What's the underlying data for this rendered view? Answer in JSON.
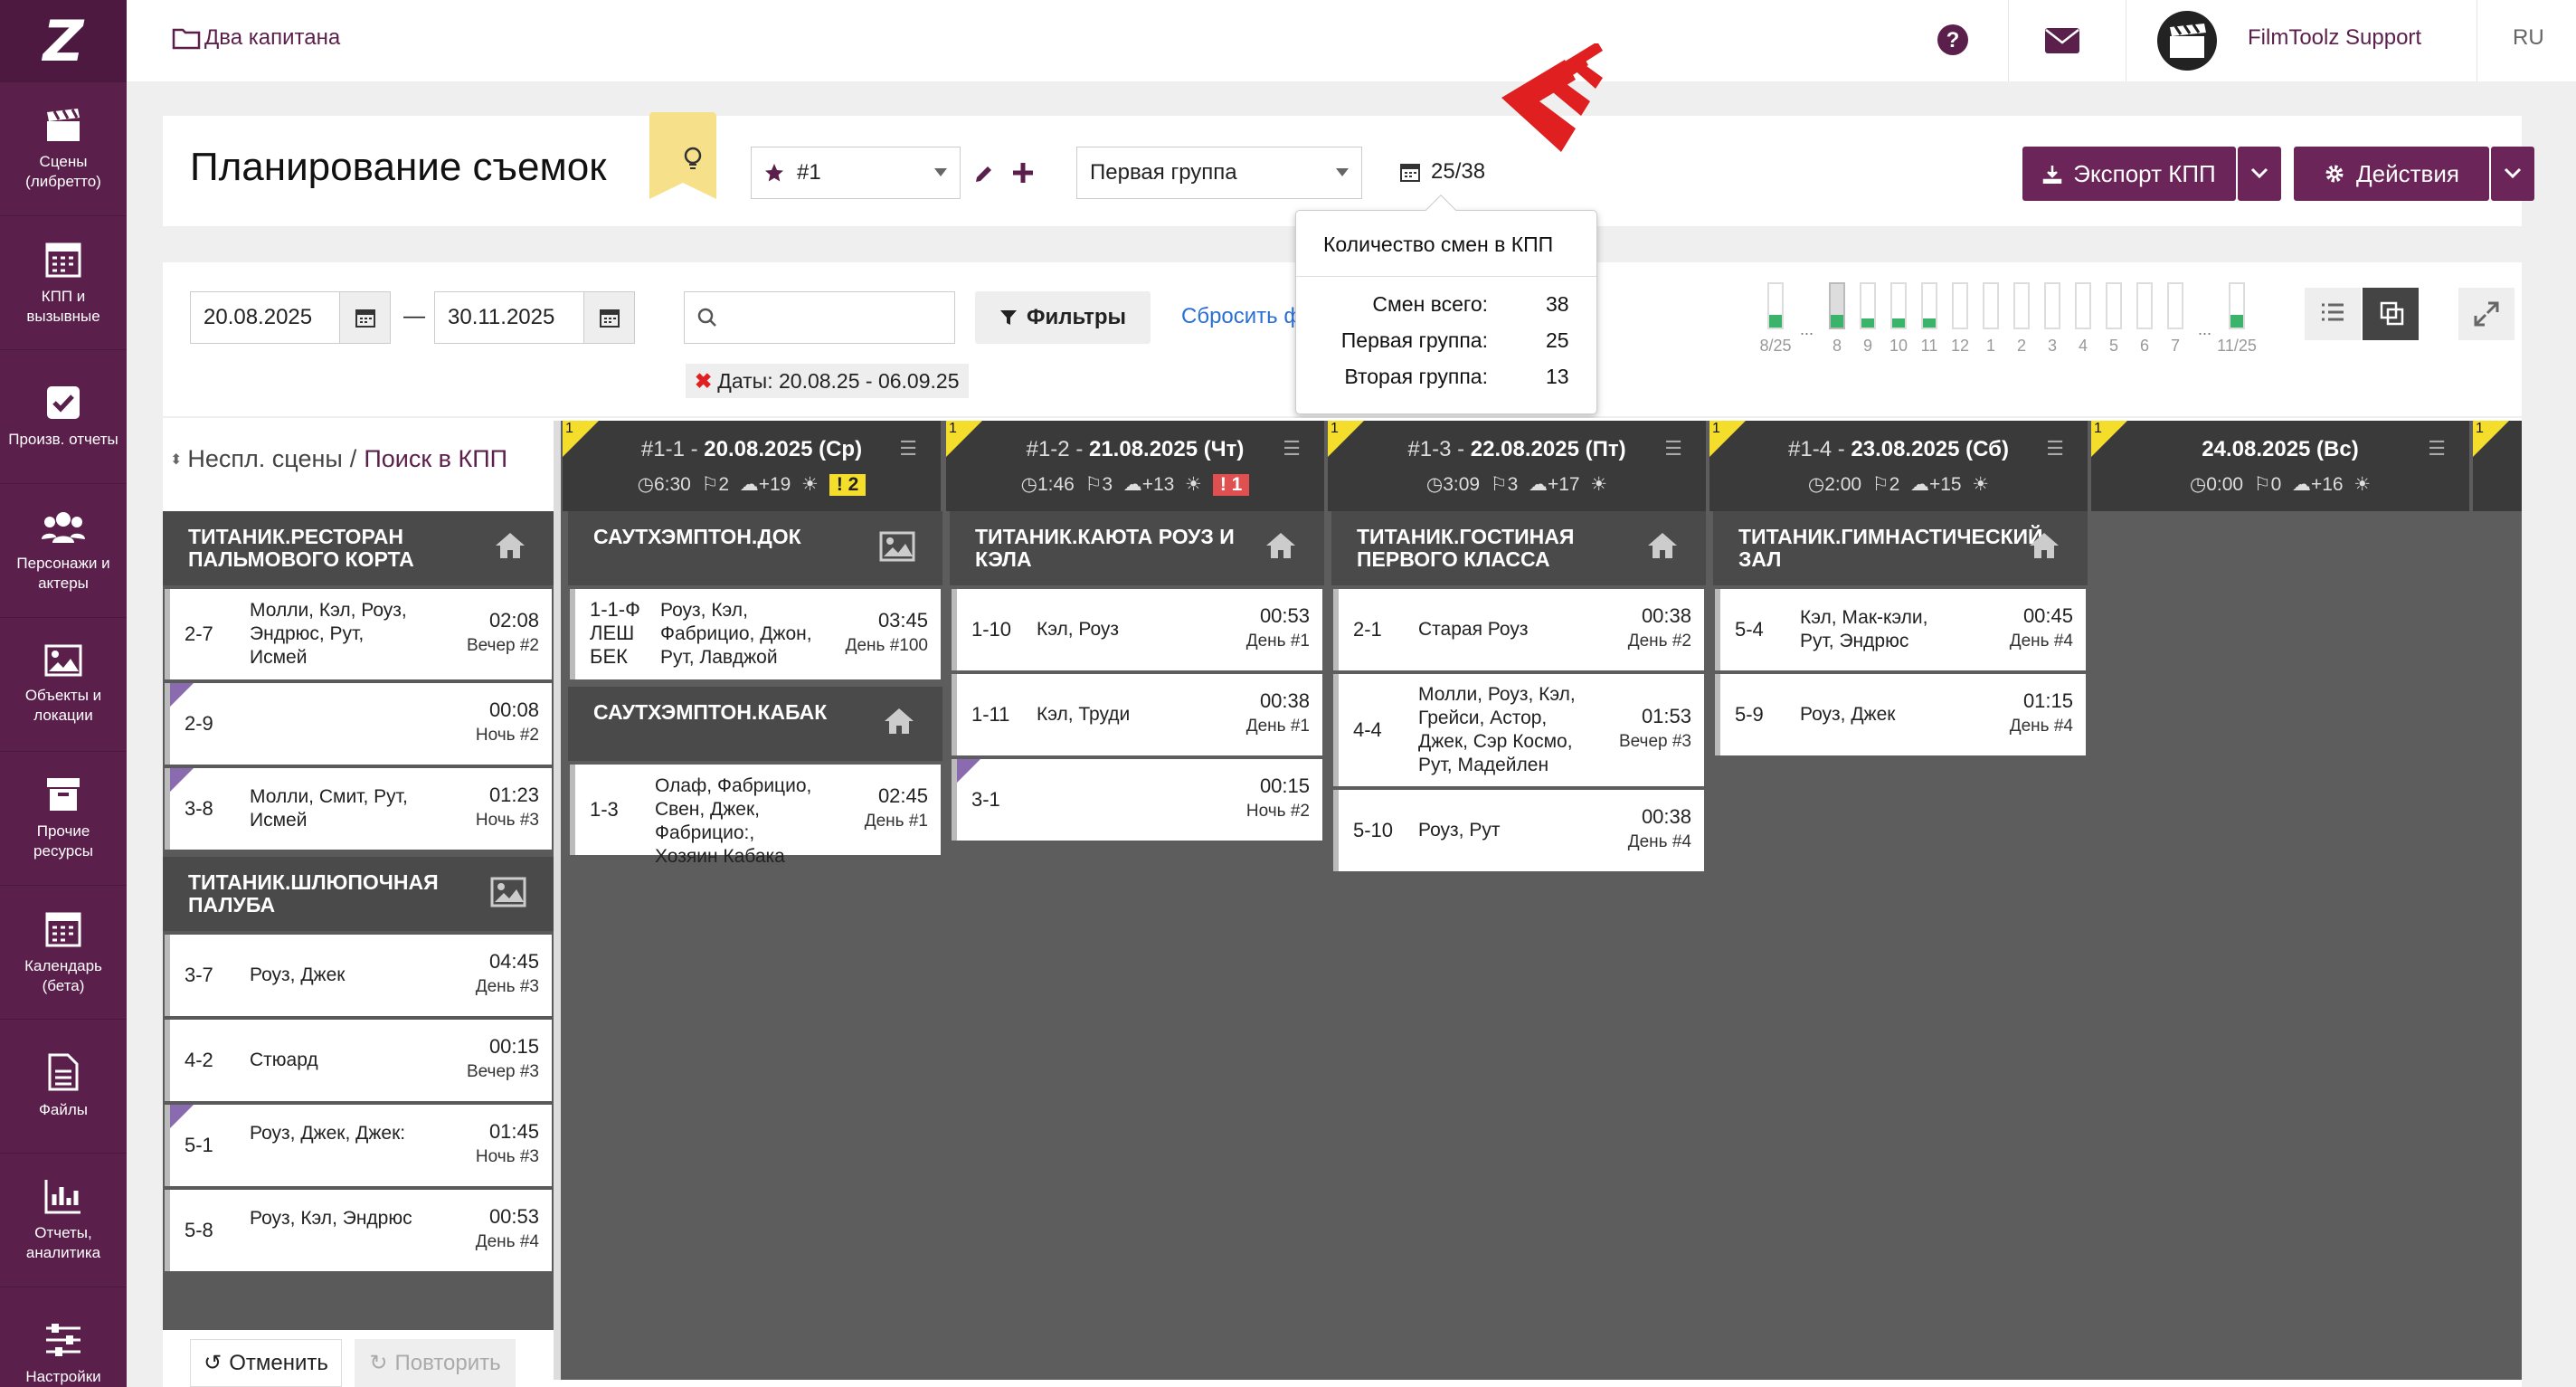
{
  "nav": [
    {
      "label": "Сцены\n(либретто)",
      "icon": "clapperboard-icon"
    },
    {
      "label": "КПП и\nвызывные",
      "icon": "calendar-grid-icon"
    },
    {
      "label": "Произв. отчеты",
      "icon": "checkbox-icon"
    },
    {
      "label": "Персонажи и\nактеры",
      "icon": "people-icon"
    },
    {
      "label": "Объекты и\nлокации",
      "icon": "image-icon"
    },
    {
      "label": "Прочие\nресурсы",
      "icon": "box-icon"
    },
    {
      "label": "Календарь\n(бета)",
      "icon": "calendar-icon"
    },
    {
      "label": "Файлы",
      "icon": "file-icon"
    },
    {
      "label": "Отчеты,\nаналитика",
      "icon": "bar-chart-icon"
    },
    {
      "label": "Настройки",
      "icon": "sliders-icon"
    }
  ],
  "topbar": {
    "project": "Два капитана",
    "user": "FilmToolz Support",
    "lang": "RU"
  },
  "header": {
    "title": "Планирование съемок",
    "version": "#1",
    "group": "Первая группа",
    "counter": "25/38",
    "export": "Экспорт КПП",
    "actions": "Действия"
  },
  "tooltip": {
    "title": "Количество смен в КПП",
    "rows": [
      {
        "k": "Смен всего:",
        "v": "38"
      },
      {
        "k": "Первая группа:",
        "v": "25"
      },
      {
        "k": "Вторая группа:",
        "v": "13"
      }
    ]
  },
  "filters": {
    "date_from": "20.08.2025",
    "dash": "—",
    "date_to": "30.11.2025",
    "filters_btn": "Фильтры",
    "reset": "Сбросить ф",
    "chip": "Даты: 20.08.25 - 06.09.25"
  },
  "bars": {
    "labels": [
      "8/25",
      "8",
      "9",
      "10",
      "11",
      "12",
      "1",
      "2",
      "3",
      "4",
      "5",
      "6",
      "7",
      "11/25"
    ],
    "ellipsis": "...",
    "fills": [
      0.3,
      0.3,
      0.2,
      0.2,
      0.2,
      0,
      0,
      0,
      0,
      0,
      0,
      0,
      0,
      0.3
    ]
  },
  "leftcol": {
    "unscheduled": "Неспл. сцены",
    "slash": "/",
    "search": "Поиск в КПП"
  },
  "unscheduled": [
    {
      "loc": "ТИТАНИК.РЕСТОРАН ПАЛЬМОВОГО КОРТА",
      "icon": "home-icon",
      "scenes": [
        {
          "no": "2-7",
          "chars": "Молли, Кэл, Роуз, Эндрюс, Рут, Исмей",
          "time": "02:08",
          "day": "Вечер #2",
          "mark": false
        },
        {
          "no": "2-9",
          "chars": "",
          "time": "00:08",
          "day": "Ночь #2",
          "mark": true
        },
        {
          "no": "3-8",
          "chars": "Молли, Смит, Рут, Исмей",
          "time": "01:23",
          "day": "Ночь #3",
          "mark": true
        }
      ]
    },
    {
      "loc": "ТИТАНИК.ШЛЮПОЧНАЯ ПАЛУБА",
      "icon": "image-icon",
      "scenes": [
        {
          "no": "3-7",
          "chars": "Роуз, Джек",
          "time": "04:45",
          "day": "День #3",
          "mark": false
        },
        {
          "no": "4-2",
          "chars": "Стюард",
          "time": "00:15",
          "day": "Вечер #3",
          "mark": false
        },
        {
          "no": "5-1",
          "chars": "Роуз, Джек, Джек:",
          "time": "01:45",
          "day": "Ночь #3",
          "mark": true
        },
        {
          "no": "5-8",
          "chars": "Роуз, Кэл, Эндрюс",
          "time": "00:53",
          "day": "День #4",
          "mark": false
        }
      ]
    }
  ],
  "undo": {
    "cancel": "Отменить",
    "repeat": "Повторить"
  },
  "days": [
    {
      "idx": "#1-1 -",
      "date": "20.08.2025 (Ср)",
      "time": "6:30",
      "scenes": "2",
      "temp": "+19",
      "badge": "2",
      "badge_color": "#f5dd2c",
      "corner": "1"
    },
    {
      "idx": "#1-2 -",
      "date": "21.08.2025 (Чт)",
      "time": "1:46",
      "scenes": "3",
      "temp": "+13",
      "badge": "1",
      "badge_color": "#e05050",
      "corner": "1"
    },
    {
      "idx": "#1-3 -",
      "date": "22.08.2025 (Пт)",
      "time": "3:09",
      "scenes": "3",
      "temp": "+17",
      "badge": "",
      "badge_color": "",
      "corner": "1"
    },
    {
      "idx": "#1-4 -",
      "date": "23.08.2025 (Сб)",
      "time": "2:00",
      "scenes": "2",
      "temp": "+15",
      "badge": "",
      "badge_color": "",
      "corner": "1"
    },
    {
      "idx": "",
      "date": "24.08.2025 (Вс)",
      "time": "0:00",
      "scenes": "0",
      "temp": "+16",
      "badge": "",
      "badge_color": "",
      "corner": "1"
    }
  ],
  "corner_extra": "1",
  "columns": [
    [
      {
        "loc": "САУТХЭМПТОН.ДОК",
        "icon": "image-icon",
        "scenes": [
          {
            "no": "1-1-ФЛЕШБЕК",
            "chars": "Роуз, Кэл, Фабрицио, Джон, Рут, Лавджой",
            "time": "03:45",
            "day": "День #100",
            "mark": false
          }
        ]
      },
      {
        "loc": "САУТХЭМПТОН.КАБАК",
        "icon": "home-icon",
        "scenes": [
          {
            "no": "1-3",
            "chars": "Олаф, Фабрицио, Свен, Джек, Фабрицио:, Хозяин Кабака",
            "time": "02:45",
            "day": "День #1",
            "mark": false
          }
        ]
      }
    ],
    [
      {
        "loc": "ТИТАНИК.КАЮТА РОУЗ И КЭЛА",
        "icon": "home-icon",
        "scenes": [
          {
            "no": "1-10",
            "chars": "Кэл, Роуз",
            "time": "00:53",
            "day": "День #1",
            "mark": false
          },
          {
            "no": "1-11",
            "chars": "Кэл, Труди",
            "time": "00:38",
            "day": "День #1",
            "mark": false
          },
          {
            "no": "3-1",
            "chars": "",
            "time": "00:15",
            "day": "Ночь #2",
            "mark": true
          }
        ]
      }
    ],
    [
      {
        "loc": "ТИТАНИК.ГОСТИНАЯ ПЕРВОГО КЛАССА",
        "icon": "home-icon",
        "scenes": [
          {
            "no": "2-1",
            "chars": "Старая Роуз",
            "time": "00:38",
            "day": "День #2",
            "mark": false
          },
          {
            "no": "4-4",
            "chars": "Молли, Роуз, Кэл, Грейси, Астор, Джек, Сэр Космо, Рут, Мадейлен",
            "time": "01:53",
            "day": "Вечер #3",
            "mark": false
          },
          {
            "no": "5-10",
            "chars": "Роуз, Рут",
            "time": "00:38",
            "day": "День #4",
            "mark": false
          }
        ]
      }
    ],
    [
      {
        "loc": "ТИТАНИК.ГИМНАСТИЧЕСКИЙ ЗАЛ",
        "icon": "home-icon",
        "scenes": [
          {
            "no": "5-4",
            "chars": "Кэл, Мак-кэли, Рут, Эндрюс",
            "time": "00:45",
            "day": "День #4",
            "mark": false
          },
          {
            "no": "5-9",
            "chars": "Роуз, Джек",
            "time": "01:15",
            "day": "День #4",
            "mark": false
          }
        ]
      }
    ]
  ],
  "colors": {
    "brand": "#5b1f4b",
    "button": "#6b2559",
    "accent_red": "#e02020",
    "badge_yellow": "#f5dd2c",
    "badge_red": "#e05050",
    "green": "#3bb36b",
    "link": "#2a6fd6"
  }
}
